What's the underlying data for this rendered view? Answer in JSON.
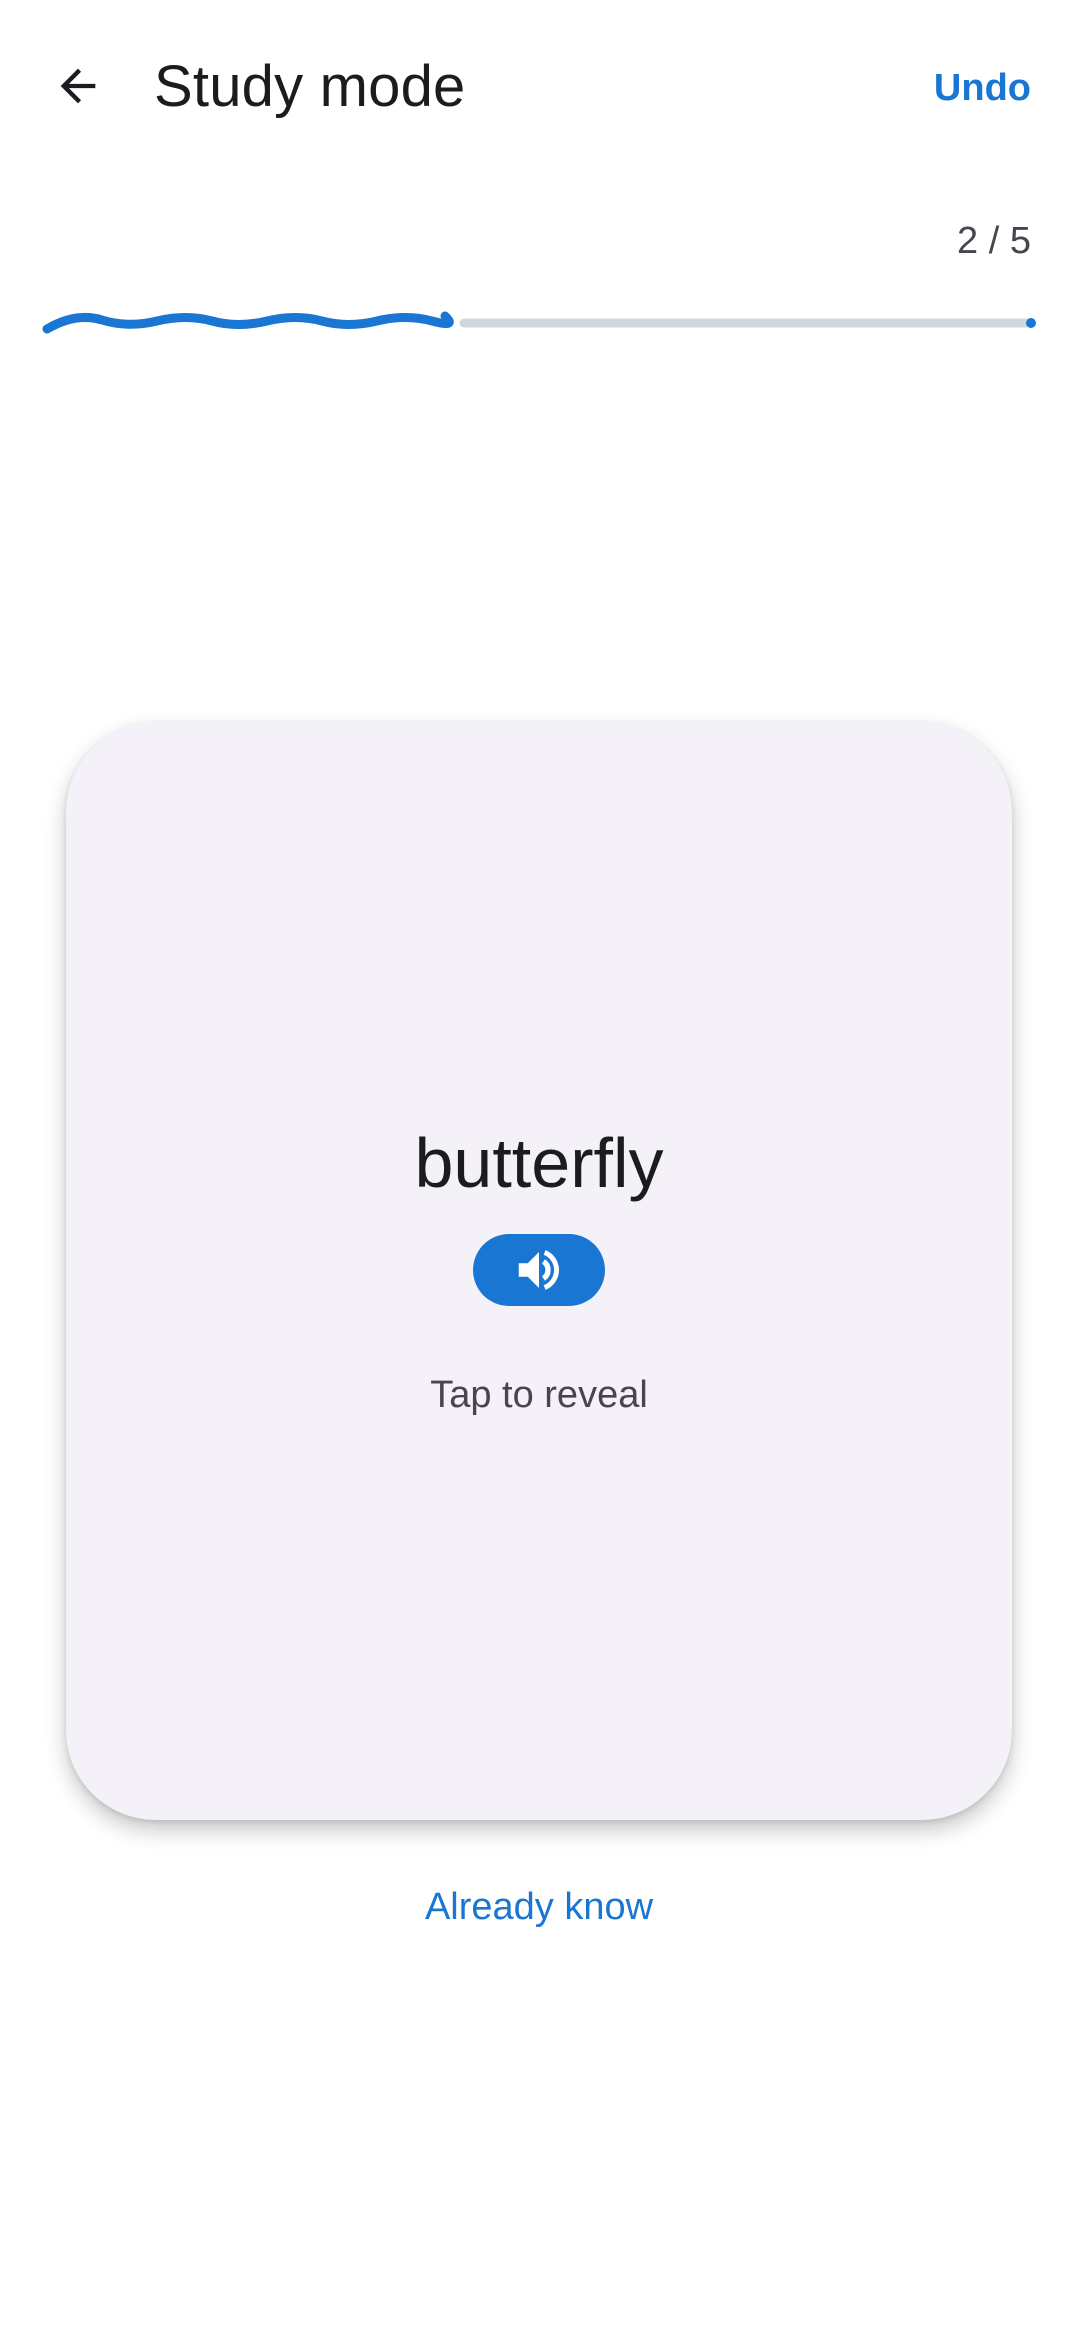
{
  "header": {
    "title": "Study mode",
    "undo_label": "Undo",
    "back_icon": "arrow-back-icon"
  },
  "progress": {
    "label": "2 / 5",
    "current": 2,
    "total": 5,
    "fraction": 0.4
  },
  "card": {
    "word": "butterfly",
    "hint": "Tap to reveal",
    "audio_icon": "speaker-icon"
  },
  "actions": {
    "already_know_label": "Already know"
  },
  "colors": {
    "accent": "#1976d2",
    "track": "#cfd8dc",
    "card_bg": "#f5f1f8",
    "text_primary": "#1c1b1f",
    "text_secondary": "#49454f"
  }
}
